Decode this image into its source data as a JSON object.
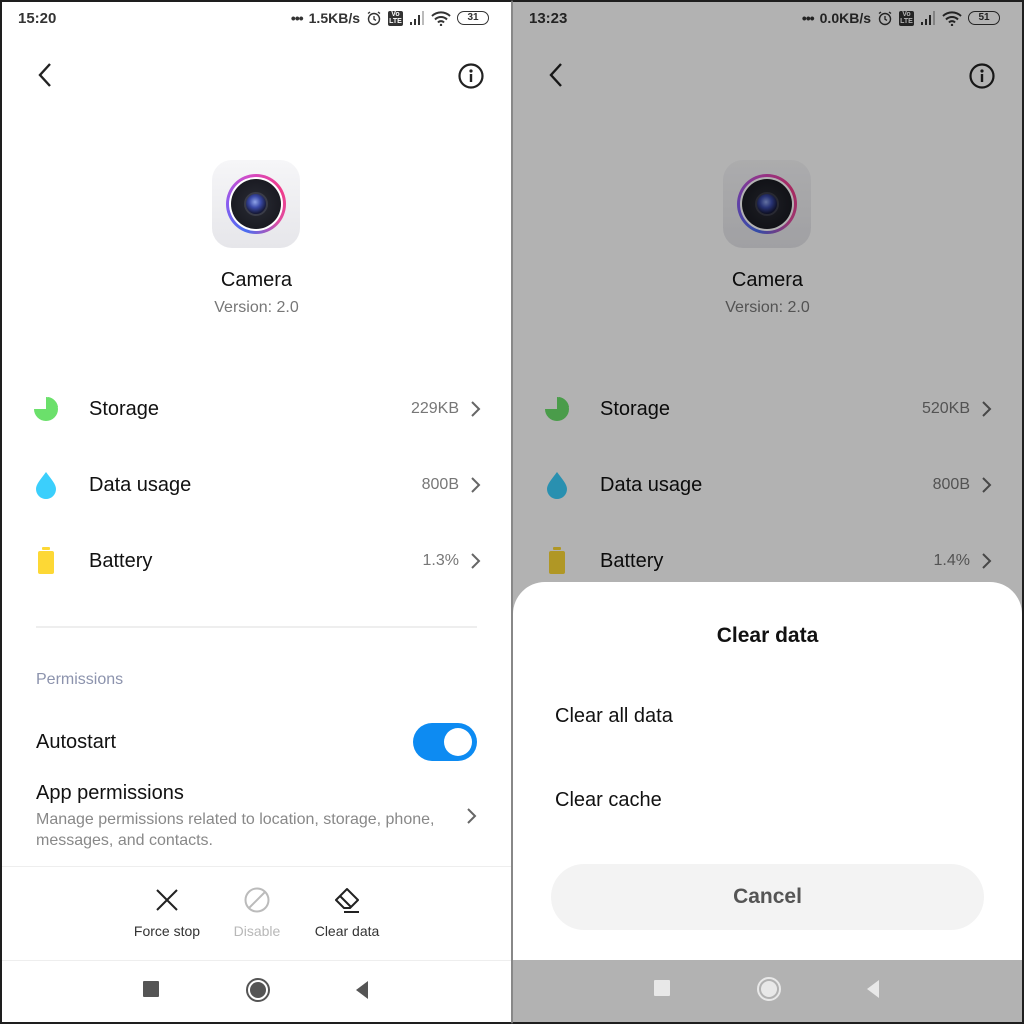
{
  "left": {
    "status_bar": {
      "time": "15:20",
      "net_speed": "1.5KB/s",
      "battery": "31",
      "icons": [
        "more-dots-icon",
        "alarm-icon",
        "volte-icon",
        "signal-icon",
        "wifi-icon",
        "battery-icon"
      ]
    },
    "header": {
      "back_icon": "chevron-left-icon",
      "info_icon": "info-icon"
    },
    "app": {
      "name": "Camera",
      "version": "Version: 2.0"
    },
    "rows": [
      {
        "label": "Storage",
        "value": "229KB",
        "icon": "pie-chart-icon",
        "color": "#6be06b"
      },
      {
        "label": "Data usage",
        "value": "800B",
        "icon": "water-drop-icon",
        "color": "#3bcffc"
      },
      {
        "label": "Battery",
        "value": "1.3%",
        "icon": "battery-icon",
        "color": "#fdd835"
      }
    ],
    "permissions": {
      "section_label": "Permissions",
      "autostart_label": "Autostart",
      "autostart_on": true,
      "app_permissions_title": "App permissions",
      "app_permissions_desc": "Manage permissions related to location, storage, phone, messages, and contacts."
    },
    "actions": [
      {
        "label": "Force stop",
        "icon": "close-x-icon",
        "enabled": true
      },
      {
        "label": "Disable",
        "icon": "block-icon",
        "enabled": false
      },
      {
        "label": "Clear data",
        "icon": "eraser-icon",
        "enabled": true
      }
    ],
    "nav": [
      "recents-square-icon",
      "home-circle-icon",
      "back-triangle-icon"
    ]
  },
  "right": {
    "status_bar": {
      "time": "13:23",
      "net_speed": "0.0KB/s",
      "battery": "51"
    },
    "app": {
      "name": "Camera",
      "version": "Version: 2.0"
    },
    "rows": [
      {
        "label": "Storage",
        "value": "520KB",
        "color": "#4caf50"
      },
      {
        "label": "Data usage",
        "value": "800B",
        "color": "#2a9dc4"
      },
      {
        "label": "Battery",
        "value": "1.4%",
        "color": "#c4a42a"
      }
    ],
    "dialog": {
      "title": "Clear data",
      "options": [
        "Clear all data",
        "Clear cache"
      ],
      "cancel_label": "Cancel"
    }
  },
  "colors": {
    "accent": "#0d8bf2",
    "scrim": "#b2b2b2",
    "section_label": "#8c93ad"
  }
}
